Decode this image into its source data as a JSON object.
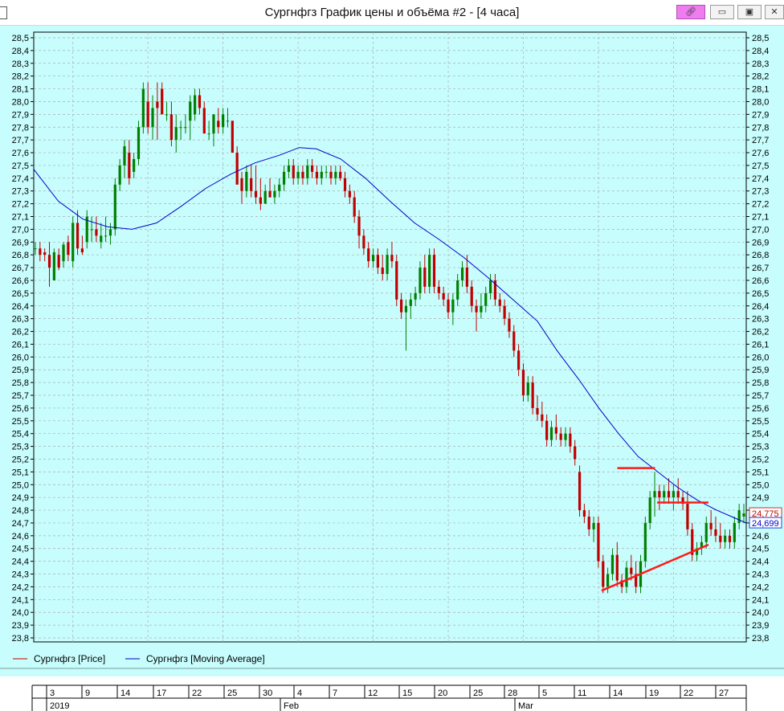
{
  "window": {
    "title": "Сургнфгз График цены и объёма #2 - [4 часа]",
    "buttons": [
      "link",
      "minimize",
      "maximize",
      "close"
    ]
  },
  "colors": {
    "plot_bg": "#c8fdfd",
    "panel_bg": "#c8fdfd",
    "grid": "#a9b0b0",
    "up_candle": "#008000",
    "down_candle": "#c00000",
    "moving_average": "#0000c8",
    "trend_lines": "#ff1a1a",
    "price_label_border": "#d03030",
    "ma_label_border": "#2040d0"
  },
  "chart_data": {
    "type": "candlestick",
    "title": "",
    "y_axis": {
      "min": 23.8,
      "max": 28.5,
      "step": 0.1,
      "decimal_separator": ",",
      "labels_on": [
        "left",
        "right"
      ]
    },
    "grid": true,
    "candles_ohlc": [
      [
        26.85,
        26.9,
        26.8,
        26.85
      ],
      [
        26.85,
        26.9,
        26.75,
        26.8
      ],
      [
        26.82,
        26.85,
        26.75,
        26.8
      ],
      [
        26.8,
        26.9,
        26.55,
        26.7
      ],
      [
        26.6,
        26.85,
        26.6,
        26.82
      ],
      [
        26.8,
        26.85,
        26.68,
        26.7
      ],
      [
        26.75,
        26.9,
        26.7,
        26.88
      ],
      [
        26.9,
        26.95,
        26.75,
        26.8
      ],
      [
        26.75,
        27.1,
        26.7,
        27.05
      ],
      [
        27.05,
        27.15,
        26.8,
        26.85
      ],
      [
        26.85,
        26.95,
        26.8,
        26.82
      ],
      [
        26.9,
        27.15,
        26.85,
        27.1
      ],
      [
        27.0,
        27.1,
        26.9,
        27.0
      ],
      [
        27.0,
        27.1,
        26.9,
        26.95
      ],
      [
        26.9,
        27.05,
        26.85,
        26.95
      ],
      [
        26.95,
        27.1,
        26.9,
        26.95
      ],
      [
        26.95,
        27.05,
        26.88,
        27.0
      ],
      [
        27.0,
        27.4,
        26.95,
        27.35
      ],
      [
        27.35,
        27.55,
        27.3,
        27.5
      ],
      [
        27.5,
        27.7,
        27.4,
        27.65
      ],
      [
        27.6,
        27.7,
        27.35,
        27.4
      ],
      [
        27.45,
        27.6,
        27.4,
        27.55
      ],
      [
        27.55,
        27.85,
        27.5,
        27.8
      ],
      [
        27.8,
        28.15,
        27.75,
        28.1
      ],
      [
        28.0,
        28.15,
        27.75,
        27.8
      ],
      [
        27.8,
        28.05,
        27.7,
        27.95
      ],
      [
        28.0,
        28.15,
        27.7,
        27.95
      ],
      [
        28.1,
        28.15,
        27.9,
        27.9
      ],
      [
        27.9,
        28.0,
        27.85,
        27.9
      ],
      [
        27.9,
        28.0,
        27.65,
        27.7
      ],
      [
        27.7,
        27.9,
        27.6,
        27.8
      ],
      [
        27.8,
        27.85,
        27.7,
        27.8
      ],
      [
        27.8,
        27.9,
        27.75,
        27.8
      ],
      [
        27.85,
        28.05,
        27.7,
        28.0
      ],
      [
        27.9,
        28.1,
        27.85,
        28.05
      ],
      [
        28.05,
        28.1,
        27.9,
        27.95
      ],
      [
        27.95,
        28.0,
        27.75,
        27.75
      ],
      [
        27.75,
        27.85,
        27.7,
        27.75
      ],
      [
        27.75,
        27.9,
        27.65,
        27.9
      ],
      [
        27.85,
        27.95,
        27.75,
        27.8
      ],
      [
        27.8,
        27.95,
        27.75,
        27.9
      ],
      [
        27.85,
        27.95,
        27.8,
        27.85
      ],
      [
        27.85,
        27.85,
        27.6,
        27.6
      ],
      [
        27.6,
        27.65,
        27.35,
        27.35
      ],
      [
        27.4,
        27.45,
        27.2,
        27.3
      ],
      [
        27.3,
        27.5,
        27.25,
        27.45
      ],
      [
        27.4,
        27.5,
        27.25,
        27.3
      ],
      [
        27.3,
        27.5,
        27.2,
        27.25
      ],
      [
        27.25,
        27.4,
        27.15,
        27.2
      ],
      [
        27.2,
        27.35,
        27.2,
        27.3
      ],
      [
        27.3,
        27.4,
        27.25,
        27.25
      ],
      [
        27.25,
        27.35,
        27.2,
        27.3
      ],
      [
        27.3,
        27.4,
        27.25,
        27.35
      ],
      [
        27.35,
        27.5,
        27.3,
        27.45
      ],
      [
        27.45,
        27.55,
        27.4,
        27.5
      ],
      [
        27.5,
        27.55,
        27.35,
        27.4
      ],
      [
        27.4,
        27.5,
        27.35,
        27.45
      ],
      [
        27.45,
        27.5,
        27.35,
        27.4
      ],
      [
        27.4,
        27.55,
        27.35,
        27.5
      ],
      [
        27.5,
        27.55,
        27.4,
        27.45
      ],
      [
        27.45,
        27.5,
        27.35,
        27.4
      ],
      [
        27.4,
        27.5,
        27.35,
        27.45
      ],
      [
        27.45,
        27.5,
        27.4,
        27.45
      ],
      [
        27.45,
        27.5,
        27.35,
        27.4
      ],
      [
        27.4,
        27.5,
        27.35,
        27.45
      ],
      [
        27.45,
        27.5,
        27.38,
        27.4
      ],
      [
        27.4,
        27.45,
        27.25,
        27.3
      ],
      [
        27.3,
        27.35,
        27.2,
        27.25
      ],
      [
        27.25,
        27.3,
        27.05,
        27.1
      ],
      [
        27.1,
        27.15,
        26.85,
        26.95
      ],
      [
        26.95,
        27.0,
        26.8,
        26.85
      ],
      [
        26.85,
        26.9,
        26.7,
        26.75
      ],
      [
        26.75,
        26.85,
        26.7,
        26.8
      ],
      [
        26.8,
        26.85,
        26.65,
        26.7
      ],
      [
        26.7,
        26.8,
        26.6,
        26.65
      ],
      [
        26.65,
        26.85,
        26.6,
        26.8
      ],
      [
        26.8,
        26.9,
        26.7,
        26.75
      ],
      [
        26.75,
        26.8,
        26.4,
        26.45
      ],
      [
        26.45,
        26.5,
        26.3,
        26.35
      ],
      [
        26.35,
        26.45,
        26.05,
        26.4
      ],
      [
        26.4,
        26.5,
        26.3,
        26.45
      ],
      [
        26.45,
        26.55,
        26.4,
        26.5
      ],
      [
        26.5,
        26.75,
        26.45,
        26.7
      ],
      [
        26.7,
        26.8,
        26.5,
        26.55
      ],
      [
        26.55,
        26.85,
        26.5,
        26.8
      ],
      [
        26.8,
        26.85,
        26.5,
        26.55
      ],
      [
        26.55,
        26.6,
        26.45,
        26.5
      ],
      [
        26.5,
        26.55,
        26.4,
        26.45
      ],
      [
        26.45,
        26.5,
        26.3,
        26.35
      ],
      [
        26.35,
        26.5,
        26.25,
        26.45
      ],
      [
        26.45,
        26.65,
        26.4,
        26.6
      ],
      [
        26.6,
        26.75,
        26.55,
        26.7
      ],
      [
        26.7,
        26.8,
        26.5,
        26.55
      ],
      [
        26.55,
        26.6,
        26.35,
        26.4
      ],
      [
        26.4,
        26.45,
        26.2,
        26.35
      ],
      [
        26.35,
        26.5,
        26.3,
        26.4
      ],
      [
        26.4,
        26.55,
        26.35,
        26.5
      ],
      [
        26.5,
        26.65,
        26.45,
        26.6
      ],
      [
        26.6,
        26.65,
        26.4,
        26.45
      ],
      [
        26.45,
        26.5,
        26.35,
        26.4
      ],
      [
        26.4,
        26.45,
        26.25,
        26.3
      ],
      [
        26.3,
        26.35,
        26.15,
        26.2
      ],
      [
        26.2,
        26.25,
        26.0,
        26.05
      ],
      [
        26.05,
        26.1,
        25.85,
        25.9
      ],
      [
        25.9,
        25.95,
        25.65,
        25.7
      ],
      [
        25.7,
        25.85,
        25.65,
        25.8
      ],
      [
        25.8,
        25.85,
        25.55,
        25.6
      ],
      [
        25.6,
        25.7,
        25.5,
        25.55
      ],
      [
        25.55,
        25.65,
        25.45,
        25.5
      ],
      [
        25.5,
        25.55,
        25.3,
        25.35
      ],
      [
        25.35,
        25.5,
        25.3,
        25.45
      ],
      [
        25.45,
        25.55,
        25.35,
        25.4
      ],
      [
        25.4,
        25.45,
        25.3,
        25.35
      ],
      [
        25.35,
        25.45,
        25.3,
        25.4
      ],
      [
        25.4,
        25.45,
        25.25,
        25.3
      ],
      [
        25.3,
        25.35,
        25.15,
        25.2
      ],
      [
        25.1,
        25.15,
        24.75,
        24.8
      ],
      [
        24.8,
        24.85,
        24.7,
        24.75
      ],
      [
        24.75,
        24.8,
        24.6,
        24.65
      ],
      [
        24.65,
        24.75,
        24.55,
        24.7
      ],
      [
        24.7,
        24.75,
        24.35,
        24.4
      ],
      [
        24.4,
        24.45,
        24.15,
        24.2
      ],
      [
        24.2,
        24.35,
        24.15,
        24.3
      ],
      [
        24.3,
        24.5,
        24.25,
        24.45
      ],
      [
        24.45,
        24.55,
        24.2,
        24.25
      ],
      [
        24.25,
        24.3,
        24.15,
        24.2
      ],
      [
        24.2,
        24.4,
        24.15,
        24.35
      ],
      [
        24.35,
        24.45,
        24.25,
        24.3
      ],
      [
        24.3,
        24.4,
        24.15,
        24.2
      ],
      [
        24.2,
        24.45,
        24.15,
        24.4
      ],
      [
        24.4,
        24.75,
        24.35,
        24.7
      ],
      [
        24.7,
        24.95,
        24.65,
        24.9
      ],
      [
        24.9,
        25.1,
        24.75,
        24.95
      ],
      [
        24.95,
        25.0,
        24.8,
        24.9
      ],
      [
        24.9,
        25.0,
        24.85,
        24.95
      ],
      [
        24.95,
        25.05,
        24.85,
        24.9
      ],
      [
        24.9,
        25.0,
        24.8,
        24.95
      ],
      [
        24.95,
        25.05,
        24.85,
        24.9
      ],
      [
        24.9,
        24.95,
        24.8,
        24.85
      ],
      [
        24.85,
        24.95,
        24.6,
        24.65
      ],
      [
        24.65,
        24.7,
        24.4,
        24.45
      ],
      [
        24.45,
        24.55,
        24.4,
        24.5
      ],
      [
        24.5,
        24.6,
        24.45,
        24.55
      ],
      [
        24.55,
        24.75,
        24.5,
        24.7
      ],
      [
        24.7,
        24.8,
        24.6,
        24.65
      ],
      [
        24.65,
        24.75,
        24.55,
        24.6
      ],
      [
        24.6,
        24.7,
        24.5,
        24.55
      ],
      [
        24.55,
        24.65,
        24.5,
        24.6
      ],
      [
        24.6,
        24.65,
        24.5,
        24.55
      ],
      [
        24.55,
        24.75,
        24.5,
        24.7
      ],
      [
        24.7,
        24.85,
        24.65,
        24.8
      ],
      [
        24.75,
        24.85,
        24.7,
        24.775
      ]
    ],
    "moving_average": [
      [
        0,
        27.47
      ],
      [
        10,
        27.22
      ],
      [
        20,
        27.08
      ],
      [
        30,
        27.02
      ],
      [
        40,
        27.0
      ],
      [
        50,
        27.05
      ],
      [
        60,
        27.18
      ],
      [
        70,
        27.32
      ],
      [
        80,
        27.43
      ],
      [
        90,
        27.52
      ],
      [
        100,
        27.58
      ],
      [
        108,
        27.64
      ],
      [
        115,
        27.63
      ],
      [
        125,
        27.55
      ],
      [
        135,
        27.4
      ],
      [
        145,
        27.22
      ],
      [
        155,
        27.05
      ],
      [
        165,
        26.92
      ],
      [
        175,
        26.78
      ],
      [
        185,
        26.62
      ],
      [
        195,
        26.45
      ],
      [
        205,
        26.28
      ],
      [
        213,
        26.05
      ],
      [
        222,
        25.82
      ],
      [
        230,
        25.6
      ],
      [
        238,
        25.4
      ],
      [
        246,
        25.22
      ],
      [
        254,
        25.1
      ],
      [
        262,
        24.98
      ],
      [
        270,
        24.88
      ],
      [
        278,
        24.8
      ],
      [
        284,
        24.75
      ],
      [
        290,
        24.7
      ]
    ],
    "trend_lines": [
      {
        "from": [
          0.819,
          25.13
        ],
        "to": [
          0.872,
          25.13
        ]
      },
      {
        "from": [
          0.875,
          24.86
        ],
        "to": [
          0.947,
          24.86
        ]
      },
      {
        "from": [
          0.797,
          24.17
        ],
        "to": [
          0.947,
          24.53
        ]
      }
    ],
    "last_price_label": "24,775",
    "ma_label": "24,699",
    "legend": [
      {
        "label": "Сургнфгз [Price]",
        "color": "#c00000"
      },
      {
        "label": "Сургнфгз [Moving Average]",
        "color": "#0000c8"
      }
    ],
    "x_axis": {
      "days": [
        "3",
        "9",
        "14",
        "17",
        "22",
        "25",
        "30",
        "4",
        "7",
        "12",
        "15",
        "20",
        "25",
        "28",
        "5",
        "11",
        "14",
        "19",
        "22",
        "27"
      ],
      "months": [
        "2019",
        "Feb",
        "Mar"
      ]
    }
  }
}
